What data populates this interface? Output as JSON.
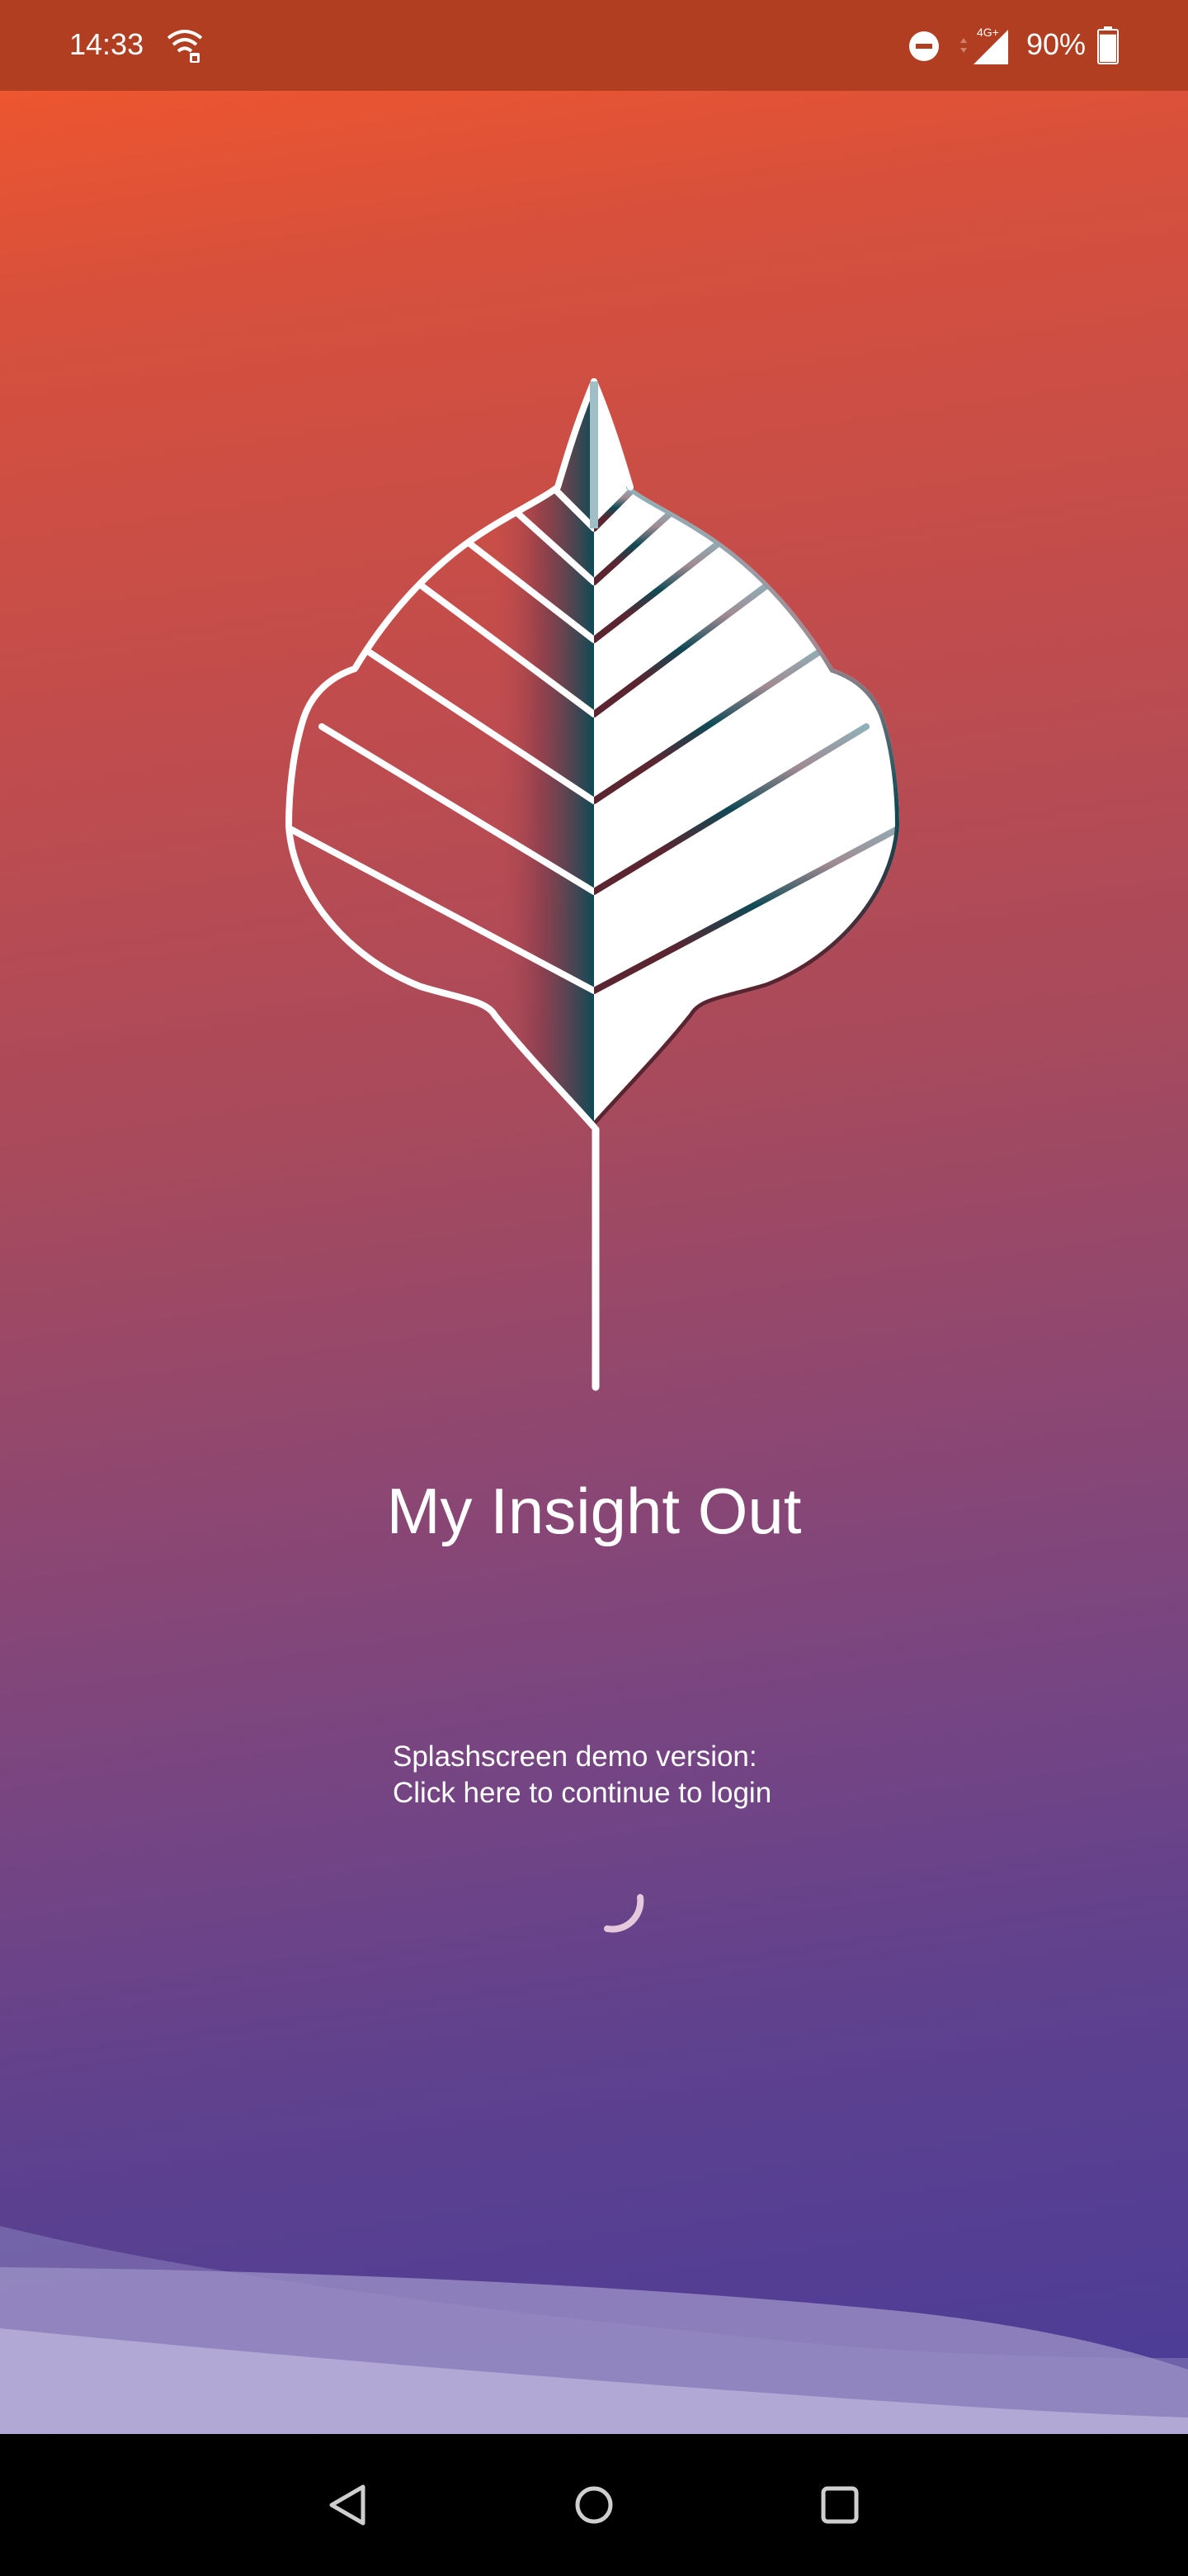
{
  "status_bar": {
    "time": "14:33",
    "network_type": "4G+",
    "battery_percent": "90%",
    "battery_level": 0.9,
    "icons": [
      "wifi-icon",
      "do-not-disturb-icon",
      "cell-signal-icon",
      "battery-icon"
    ]
  },
  "splash": {
    "title": "My Insight Out",
    "demo_line1": "Splashscreen demo version:",
    "demo_line2": "Click here to continue to login",
    "logo_icon": "leaf-logo-icon",
    "loading_icon": "loading-spinner-icon"
  },
  "nav_bar": {
    "buttons": [
      "back-icon",
      "home-icon",
      "recents-icon"
    ]
  },
  "colors": {
    "gradient_top": "#f6582a",
    "gradient_bottom": "#4a3c98",
    "status_bar_bg": "#b13e20",
    "leaf_dark": "#0e4a55",
    "leaf_maroon": "#5a2530",
    "text": "#ffffff"
  }
}
